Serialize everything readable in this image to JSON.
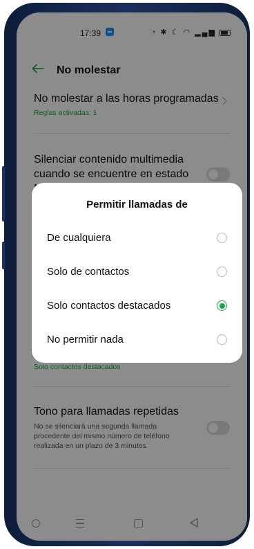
{
  "status_bar": {
    "time": "17:39",
    "icons": [
      "alarm-icon",
      "bluetooth-icon",
      "moon-icon",
      "wifi-icon",
      "signal-icon",
      "battery-icon"
    ]
  },
  "header": {
    "back_icon": "arrow-left-icon",
    "title": "No molestar"
  },
  "settings": {
    "scheduled": {
      "title": "No molestar a las horas programadas",
      "subtitle": "Reglas activadas: 1"
    },
    "mute_media": {
      "title": "Silenciar contenido multimedia cuando se encuentre en estado No"
    },
    "allow_calls_value": "Solo contactos destacados",
    "repeat_calls": {
      "title": "Tono para llamadas repetidas",
      "description": "No se silenciará una segunda llamada procedente del mismo número de teléfono realizada en un plazo de 3 minutos"
    }
  },
  "dialog": {
    "title": "Permitir llamadas de",
    "options": [
      {
        "label": "De cualquiera",
        "selected": false
      },
      {
        "label": "Solo de contactos",
        "selected": false
      },
      {
        "label": "Solo contactos destacados",
        "selected": true
      },
      {
        "label": "No permitir nada",
        "selected": false
      }
    ]
  },
  "colors": {
    "accent": "#12a84a",
    "overlay": "#000000"
  }
}
